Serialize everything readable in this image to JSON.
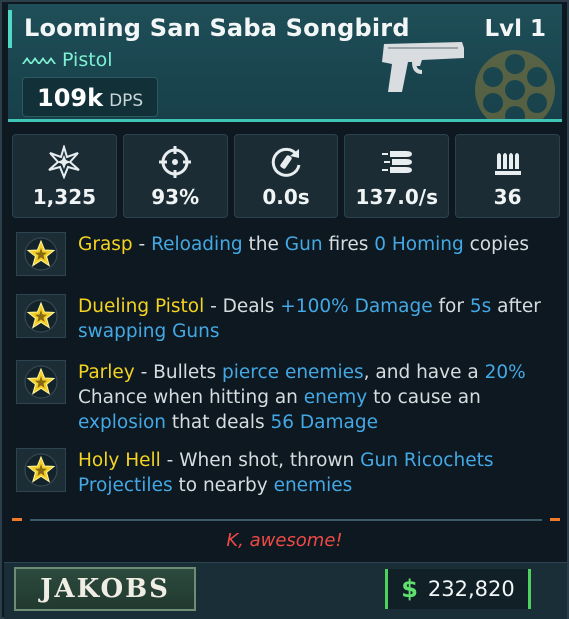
{
  "weapon": {
    "name": "Looming San Saba Songbird",
    "level": "Lvl 1",
    "type": "Pistol",
    "dps_value": "109k",
    "dps_unit": "DPS"
  },
  "stats": [
    {
      "icon": "damage-burst-icon",
      "value": "1,325"
    },
    {
      "icon": "crosshair-accuracy-icon",
      "value": "93%"
    },
    {
      "icon": "reload-time-icon",
      "value": "0.0s"
    },
    {
      "icon": "fire-rate-bullets-icon",
      "value": "137.0/s"
    },
    {
      "icon": "magazine-size-icon",
      "value": "36"
    }
  ],
  "perks": [
    {
      "icon": "star-perk-icon",
      "lines": [
        [
          {
            "t": "Grasp",
            "c": "name"
          },
          {
            "t": " - ",
            "c": ""
          },
          {
            "t": "Reloading",
            "c": "hl"
          },
          {
            "t": " the ",
            "c": ""
          },
          {
            "t": "Gun",
            "c": "hl"
          },
          {
            "t": " fires ",
            "c": ""
          },
          {
            "t": "0 Homing",
            "c": "hl"
          },
          {
            "t": " copies",
            "c": ""
          }
        ]
      ]
    },
    {
      "icon": "star-perk-icon",
      "lines": [
        [
          {
            "t": "Dueling Pistol",
            "c": "name"
          },
          {
            "t": " - Deals ",
            "c": ""
          },
          {
            "t": "+100% Damage",
            "c": "hl"
          },
          {
            "t": " for ",
            "c": ""
          },
          {
            "t": "5s",
            "c": "hl"
          },
          {
            "t": " after",
            "c": ""
          }
        ],
        [
          {
            "t": "swapping Guns",
            "c": "hl"
          }
        ]
      ]
    },
    {
      "icon": "star-perk-icon",
      "lines": [
        [
          {
            "t": "Parley",
            "c": "name"
          },
          {
            "t": " - Bullets ",
            "c": ""
          },
          {
            "t": "pierce enemies",
            "c": "hl"
          },
          {
            "t": ", and have a ",
            "c": ""
          },
          {
            "t": "20%",
            "c": "hl"
          }
        ],
        [
          {
            "t": "Chance when hitting an ",
            "c": ""
          },
          {
            "t": "enemy",
            "c": "hl"
          },
          {
            "t": " to cause an",
            "c": ""
          }
        ],
        [
          {
            "t": "explosion",
            "c": "hl"
          },
          {
            "t": " that deals ",
            "c": ""
          },
          {
            "t": "56 Damage",
            "c": "hl"
          }
        ]
      ]
    },
    {
      "icon": "star-perk-icon",
      "lines": [
        [
          {
            "t": "Holy Hell",
            "c": "name"
          },
          {
            "t": " - When shot, thrown ",
            "c": ""
          },
          {
            "t": "Gun Ricochets",
            "c": "hl"
          }
        ],
        [
          {
            "t": "Projectiles",
            "c": "hl"
          },
          {
            "t": " to nearby ",
            "c": ""
          },
          {
            "t": "enemies",
            "c": "hl"
          }
        ]
      ]
    }
  ],
  "flavor_text": "K, awesome!",
  "manufacturer": "JAKOBS",
  "price": {
    "currency_symbol": "$",
    "value": "232,820"
  },
  "colors": {
    "accent": "#3fc4b6",
    "perk_name": "#f5d321",
    "highlight": "#44a8e4",
    "flavor": "#ef4a45",
    "price_border": "#4ed25e"
  }
}
